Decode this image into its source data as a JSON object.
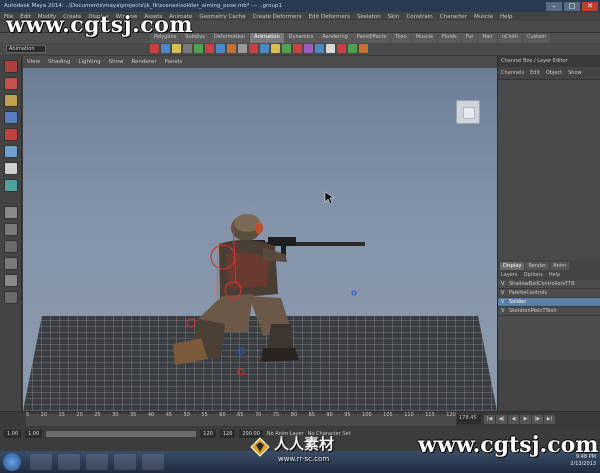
{
  "window": {
    "title": "Autodesk Maya 2014: ..\\Documents\\maya\\projects\\ik_fk\\scenes\\soldier_aiming_pose.mb* --- ..group1",
    "minimize": "–",
    "maximize": "□",
    "close": "✕"
  },
  "menubar": {
    "items": [
      "File",
      "Edit",
      "Modify",
      "Create",
      "Display",
      "Window",
      "Assets",
      "Animate",
      "Geometry Cache",
      "Create Deformers",
      "Edit Deformers",
      "Skeleton",
      "Skin",
      "Constrain",
      "Character",
      "Muscle",
      "Help"
    ]
  },
  "status_line": {
    "mode": "Animation"
  },
  "shelf": {
    "tabs": [
      "Polygons",
      "Subdivs",
      "Deformation",
      "Animation",
      "Dynamics",
      "Rendering",
      "PaintEffects",
      "Toon",
      "Muscle",
      "Fluids",
      "Fur",
      "Hair",
      "nCloth",
      "Custom"
    ],
    "active_tab": 3,
    "icon_colors": [
      "#c84040",
      "#4a88c8",
      "#d8c050",
      "#7a7a7a",
      "#50a050",
      "#c84040",
      "#4a88c8",
      "#c87030",
      "#9a9a9a",
      "#c84040",
      "#4a88c8",
      "#d8c050",
      "#50a050",
      "#c84040",
      "#9a60c0",
      "#4a88c8",
      "#d8d8d8",
      "#c84040",
      "#50a050",
      "#c87030"
    ]
  },
  "panel_menu": {
    "items": [
      "View",
      "Shading",
      "Lighting",
      "Show",
      "Renderer",
      "Panels"
    ]
  },
  "toolbox": {
    "tool_colors": [
      "#b04040",
      "#c85050",
      "#c0a050",
      "#5a7fc0",
      "#c04040",
      "#6fa0d0",
      "#d0d0d0",
      "#50a0a0",
      "#8a8a8a",
      "#7a7a7a",
      "#6a6a6a",
      "#7a7a7a",
      "#8a8a8a",
      "#6a6a6a"
    ]
  },
  "channel_box": {
    "header": "Channel Box / Layer Editor",
    "menus": [
      "Channels",
      "Edit",
      "Object",
      "Show"
    ]
  },
  "layer_editor": {
    "tabs": [
      "Display",
      "Render",
      "Anim"
    ],
    "active_tab": 0,
    "submenus": [
      "Layers",
      "Options",
      "Help"
    ],
    "layers": [
      {
        "vis": "V",
        "name": "ShadowBallControllersTTR",
        "selected": false
      },
      {
        "vis": "V",
        "name": "PaletteControls",
        "selected": false
      },
      {
        "vis": "V",
        "name": "Soldier",
        "selected": true
      },
      {
        "vis": "V",
        "name": "SkeletonMainTTesh",
        "selected": false
      }
    ]
  },
  "timeline": {
    "ticks": [
      "5",
      "10",
      "15",
      "20",
      "25",
      "30",
      "35",
      "40",
      "45",
      "50",
      "55",
      "60",
      "65",
      "70",
      "75",
      "80",
      "85",
      "90",
      "95",
      "100",
      "105",
      "110",
      "115",
      "120"
    ],
    "current_frame": "178.45",
    "playback": [
      "|◀",
      "◀|",
      "◀",
      "▶",
      "|▶",
      "▶|"
    ]
  },
  "range": {
    "start": "1.00",
    "range_start": "1.00",
    "range_end": "120",
    "end": "120",
    "end2": "200.00",
    "anim_layer": "No Anim Layer",
    "character": "No Character Set"
  },
  "taskbar": {
    "apps": [
      "explorer",
      "chrome",
      "media",
      "quicktime",
      "maya"
    ],
    "time": "9:48 PM",
    "date": "2/13/2013"
  },
  "watermark": {
    "top_url": "www.cgtsj.com",
    "bottom_url": "www.cgtsj.com",
    "cn_text": "人人素材",
    "cn_url": "www.rr-sc.com"
  }
}
